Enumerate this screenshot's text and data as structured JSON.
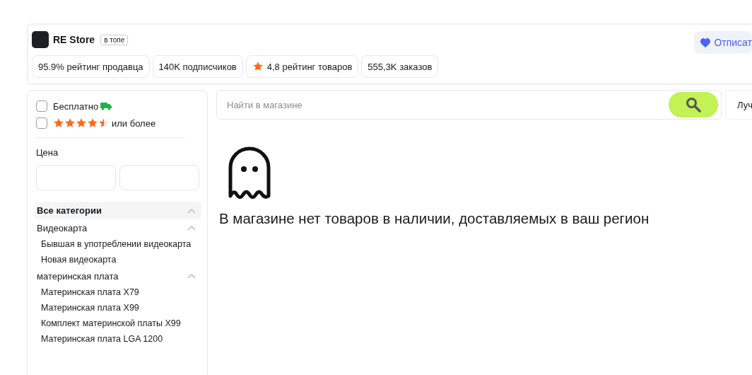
{
  "store": {
    "name": "RE Store",
    "badge": "в топе",
    "subscribe_button": "Отписат",
    "subscribed": true
  },
  "stats": [
    {
      "kind": "text",
      "label": "95.9% рейтинг продавца"
    },
    {
      "kind": "text",
      "label": "140K подписчиков"
    },
    {
      "kind": "star",
      "label": "4,8 рейтинг товаров"
    },
    {
      "kind": "text",
      "label": "555,3K заказов"
    }
  ],
  "filters": [
    {
      "kind": "free",
      "label": "Бесплатно",
      "checked": false
    },
    {
      "kind": "stars",
      "label": "или более",
      "stars": 4.5,
      "checked": false
    }
  ],
  "price": {
    "title": "Цена"
  },
  "categories": [
    {
      "label": "Все категории",
      "selected": true,
      "expanded": true,
      "children": [
        {
          "label": "Видеокарта",
          "selected": false,
          "expanded": true,
          "children": [
            {
              "label": "Бывшая в употреблении видеокарта",
              "selected": false
            },
            {
              "label": "Новая видеокарта",
              "selected": false
            }
          ]
        },
        {
          "label": "материнская плата",
          "selected": false,
          "expanded": true,
          "children": [
            {
              "label": "Материнская плата X79",
              "selected": false
            },
            {
              "label": "Материнская плата X99",
              "selected": false
            },
            {
              "label": "Комплект материнской платы X99",
              "selected": false
            },
            {
              "label": "Материнская плата LGA 1200",
              "selected": false
            }
          ]
        }
      ]
    }
  ],
  "search": {
    "placeholder": "Найти в магазине"
  },
  "sort": {
    "label": "Луч"
  },
  "empty_message": "В магазине нет товаров в наличии, доставляемых в ваш регион"
}
